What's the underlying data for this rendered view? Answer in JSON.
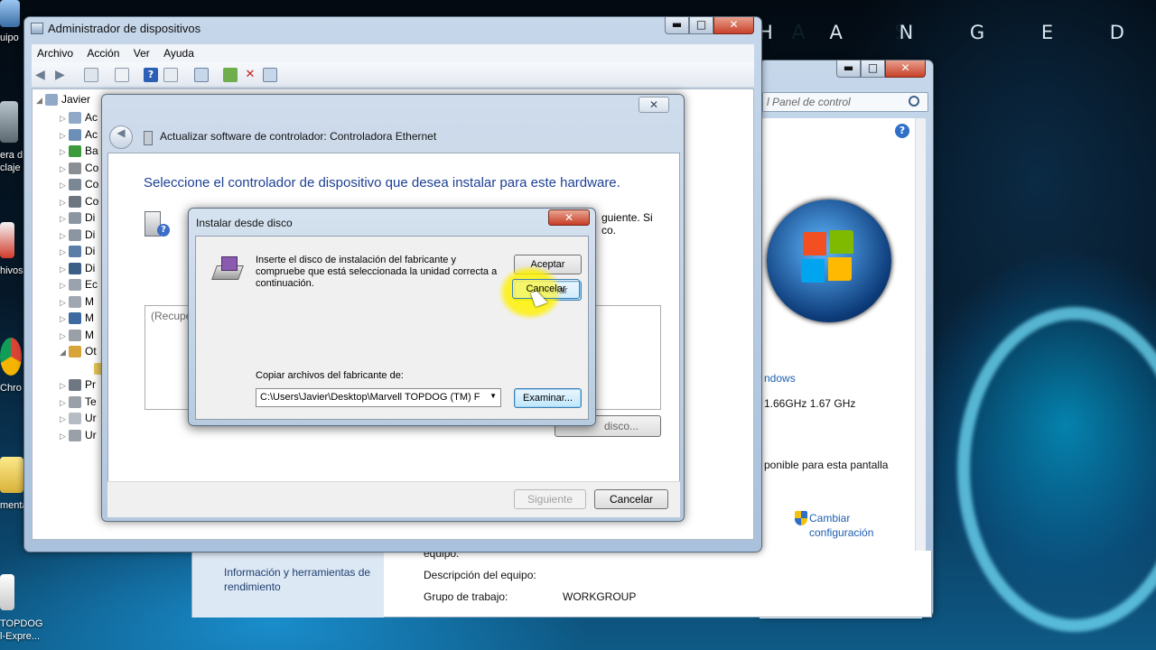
{
  "desktop": {
    "banner_dark": "G A M E H A S",
    "banner_bright": "H A N G E D",
    "icons": [
      {
        "label": "uipo"
      },
      {
        "label": "era d\nclaje"
      },
      {
        "label": "hivos"
      },
      {
        "label": "Chro"
      },
      {
        "label": "menta"
      },
      {
        "label": "TOPDOG\nI-Expre..."
      }
    ]
  },
  "control_panel": {
    "search_placeholder": "l Panel de control",
    "edition_fragment": "ndows",
    "cpu_speed": "1.66GHz  1.67 GHz",
    "pen_touch": "ponible para esta pantalla",
    "change_settings": "Cambiar\nconfiguración",
    "sidebar_link": "Información y herramientas de rendimiento",
    "computer_desc_label": "Descripción del equipo:",
    "workgroup_label": "Grupo de trabajo:",
    "workgroup_value": "WORKGROUP",
    "equipo_fragment": "equipo:",
    "colors": {
      "link": "#1f5fb0"
    }
  },
  "device_manager": {
    "title": "Administrador de dispositivos",
    "menu": [
      "Archivo",
      "Acción",
      "Ver",
      "Ayuda"
    ],
    "root": "Javier",
    "tree": [
      {
        "label": "Ac",
        "icon": "audio-device-icon"
      },
      {
        "label": "Ac",
        "icon": "adapter-icon"
      },
      {
        "label": "Ba",
        "icon": "battery-icon"
      },
      {
        "label": "Co",
        "icon": "computer-icon"
      },
      {
        "label": "Co",
        "icon": "usb-controller-icon"
      },
      {
        "label": "Co",
        "icon": "sound-icon"
      },
      {
        "label": "Di",
        "icon": "disk-drive-icon"
      },
      {
        "label": "Di",
        "icon": "disk-drive-icon"
      },
      {
        "label": "Di",
        "icon": "dvd-icon"
      },
      {
        "label": "Di",
        "icon": "display-adapter-icon"
      },
      {
        "label": "Ec",
        "icon": "ide-controller-icon"
      },
      {
        "label": "M",
        "icon": "keyboard-icon"
      },
      {
        "label": "M",
        "icon": "monitor-icon"
      },
      {
        "label": "M",
        "icon": "mouse-icon"
      },
      {
        "label": "Ot",
        "icon": "other-devices-icon"
      },
      {
        "label": "",
        "icon": "unknown-device-icon"
      },
      {
        "label": "Pr",
        "icon": "processor-icon"
      },
      {
        "label": "Te",
        "icon": "keyboard-icon"
      },
      {
        "label": "Ur",
        "icon": "storage-icon"
      },
      {
        "label": "Ur",
        "icon": "usb-icon"
      }
    ]
  },
  "wizard": {
    "title": "Actualizar software de controlador: Controladora Ethernet",
    "heading": "Seleccione el controlador de dispositivo que desea instalar para este hardware.",
    "right_fragment": "guiente. Si\nco.",
    "list_placeholder": "(Recupe",
    "have_disk_fragment": "disco...",
    "next_label": "Siguiente",
    "cancel_label": "Cancelar"
  },
  "dialog": {
    "title": "Instalar desde disco",
    "message": "Inserte el disco de instalación del fabricante y compruebe que está seleccionada la unidad correcta a continuación.",
    "ok_label": "Aceptar",
    "cancel_label": "Cancelar",
    "copy_label": "Copiar archivos del fabricante de:",
    "path_value": "C:\\Users\\Javier\\Desktop\\Marvell TOPDOG (TM) F",
    "browse_label": "Examinar..."
  }
}
